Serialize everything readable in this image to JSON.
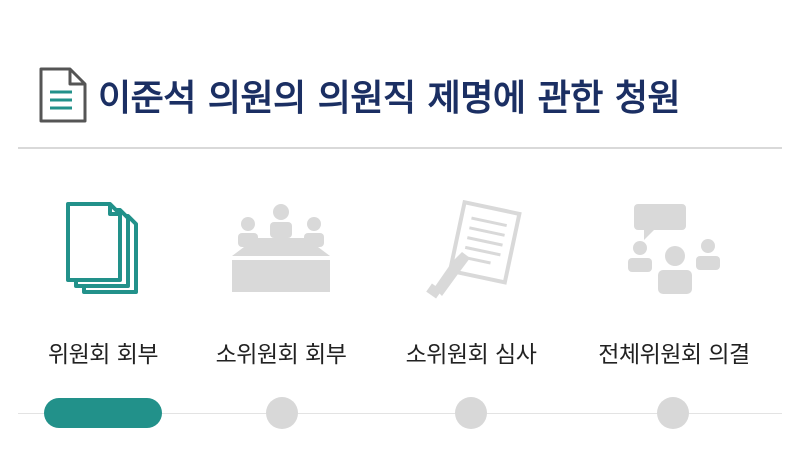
{
  "page": {
    "title": "이준석 의원의 의원직 제명에 관한 청원"
  },
  "steps": [
    {
      "label": "위원회 회부",
      "icon": "document-stack-icon",
      "state": "active"
    },
    {
      "label": "소위원회 회부",
      "icon": "meeting-table-icon",
      "state": "inactive"
    },
    {
      "label": "소위원회 심사",
      "icon": "review-document-icon",
      "state": "inactive"
    },
    {
      "label": "전체위원회 의결",
      "icon": "plenary-discussion-icon",
      "state": "inactive"
    }
  ],
  "colors": {
    "title": "#1b2f63",
    "accent": "#22918a",
    "inactive_icon": "#d9d9d9",
    "inactive_dot": "#d8d8d8"
  }
}
